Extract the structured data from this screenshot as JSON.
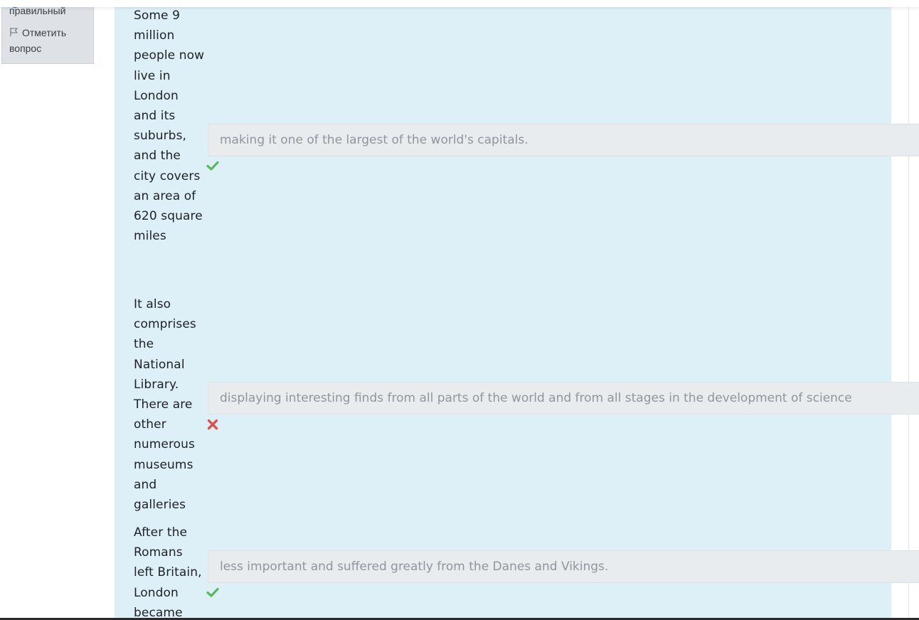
{
  "sidebar": {
    "state_text": "правильный",
    "flag_label": "Отметить вопрос"
  },
  "rows": [
    {
      "stem": "Some 9 million people now live in London and its suburbs, and the city covers an area of 620 square miles",
      "answer": "making it one of the largest of the world's capitals.",
      "status": "correct",
      "mark_icon": "check-icon"
    },
    {
      "stem": "It also comprises the National Library. There are other numerous museums and galleries",
      "answer": "displaying interesting finds from all parts of the world and from all stages in the development of science",
      "status": "incorrect",
      "mark_icon": "cross-icon"
    },
    {
      "stem": "After the Romans left Britain, London became",
      "answer": "less important and suffered greatly from the Danes and Vikings.",
      "status": "correct",
      "mark_icon": "check-icon"
    }
  ],
  "colors": {
    "content_bg": "#def0f7",
    "correct": "#5cb85c",
    "incorrect": "#d9534f",
    "answer_bg": "#e9ecef"
  }
}
